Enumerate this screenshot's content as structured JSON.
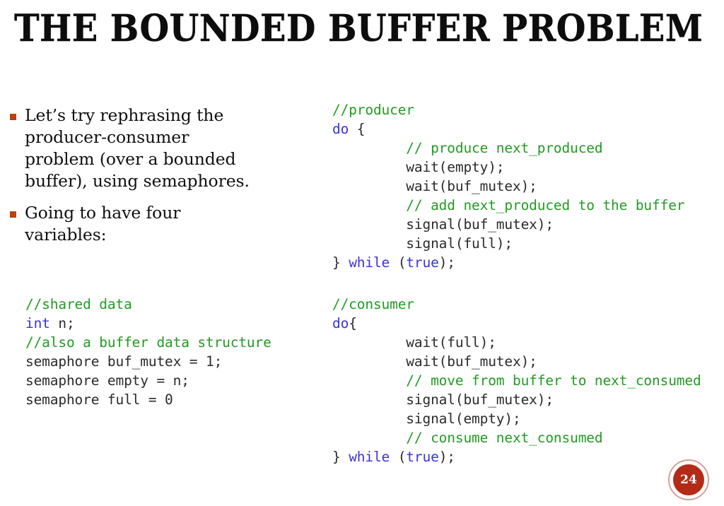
{
  "slide": {
    "title": "The Bounded Buffer Problem",
    "page_number": "24",
    "accent_color": "#b5420f",
    "badge_color": "#b32b17",
    "comment_color": "#239b23",
    "keyword_color": "#3a33e0",
    "code_color": "#2b2b2b",
    "background_color": "#ffffff"
  },
  "bullets": [
    {
      "text": "Let’s try rephrasing the producer-consumer problem (over a bounded buffer), using semaphores."
    },
    {
      "text": "Going to have four variables:"
    }
  ],
  "code_shared": {
    "lines": [
      {
        "segments": [
          {
            "cls": "cm",
            "text": "//shared data"
          }
        ]
      },
      {
        "segments": [
          {
            "cls": "kw",
            "text": "int"
          },
          {
            "cls": "pl",
            "text": " n;"
          }
        ]
      },
      {
        "segments": [
          {
            "cls": "cm",
            "text": "//also a buffer data structure"
          }
        ]
      },
      {
        "segments": [
          {
            "cls": "pl",
            "text": "semaphore buf_mutex = 1;"
          }
        ]
      },
      {
        "segments": [
          {
            "cls": "pl",
            "text": "semaphore empty = n;"
          }
        ]
      },
      {
        "segments": [
          {
            "cls": "pl",
            "text": "semaphore full = 0"
          }
        ]
      }
    ]
  },
  "code_producer": {
    "lines": [
      {
        "segments": [
          {
            "cls": "cm",
            "text": "//producer"
          }
        ]
      },
      {
        "segments": [
          {
            "cls": "kw",
            "text": "do"
          },
          {
            "cls": "pl",
            "text": " {"
          }
        ]
      },
      {
        "segments": [
          {
            "cls": "cm",
            "text": "         // produce next_produced"
          }
        ]
      },
      {
        "segments": [
          {
            "cls": "pl",
            "text": "         wait(empty);"
          }
        ]
      },
      {
        "segments": [
          {
            "cls": "pl",
            "text": "         wait(buf_mutex);"
          }
        ]
      },
      {
        "segments": [
          {
            "cls": "cm",
            "text": "         // add next_produced to the buffer"
          }
        ]
      },
      {
        "segments": [
          {
            "cls": "pl",
            "text": "         signal(buf_mutex);"
          }
        ]
      },
      {
        "segments": [
          {
            "cls": "pl",
            "text": "         signal(full);"
          }
        ]
      },
      {
        "segments": [
          {
            "cls": "pl",
            "text": "} "
          },
          {
            "cls": "kw",
            "text": "while"
          },
          {
            "cls": "pl",
            "text": " ("
          },
          {
            "cls": "kw",
            "text": "true"
          },
          {
            "cls": "pl",
            "text": ");"
          }
        ]
      }
    ]
  },
  "code_consumer": {
    "lines": [
      {
        "segments": [
          {
            "cls": "cm",
            "text": "//consumer"
          }
        ]
      },
      {
        "segments": [
          {
            "cls": "kw",
            "text": "do"
          },
          {
            "cls": "pl",
            "text": "{"
          }
        ]
      },
      {
        "segments": [
          {
            "cls": "pl",
            "text": "         wait(full);"
          }
        ]
      },
      {
        "segments": [
          {
            "cls": "pl",
            "text": "         wait(buf_mutex);"
          }
        ]
      },
      {
        "segments": [
          {
            "cls": "cm",
            "text": "         // move from buffer to next_consumed"
          }
        ]
      },
      {
        "segments": [
          {
            "cls": "pl",
            "text": "         signal(buf_mutex);"
          }
        ]
      },
      {
        "segments": [
          {
            "cls": "pl",
            "text": "         signal(empty);"
          }
        ]
      },
      {
        "segments": [
          {
            "cls": "cm",
            "text": "         // consume next_consumed"
          }
        ]
      },
      {
        "segments": [
          {
            "cls": "pl",
            "text": "} "
          },
          {
            "cls": "kw",
            "text": "while"
          },
          {
            "cls": "pl",
            "text": " ("
          },
          {
            "cls": "kw",
            "text": "true"
          },
          {
            "cls": "pl",
            "text": ");"
          }
        ]
      }
    ]
  }
}
